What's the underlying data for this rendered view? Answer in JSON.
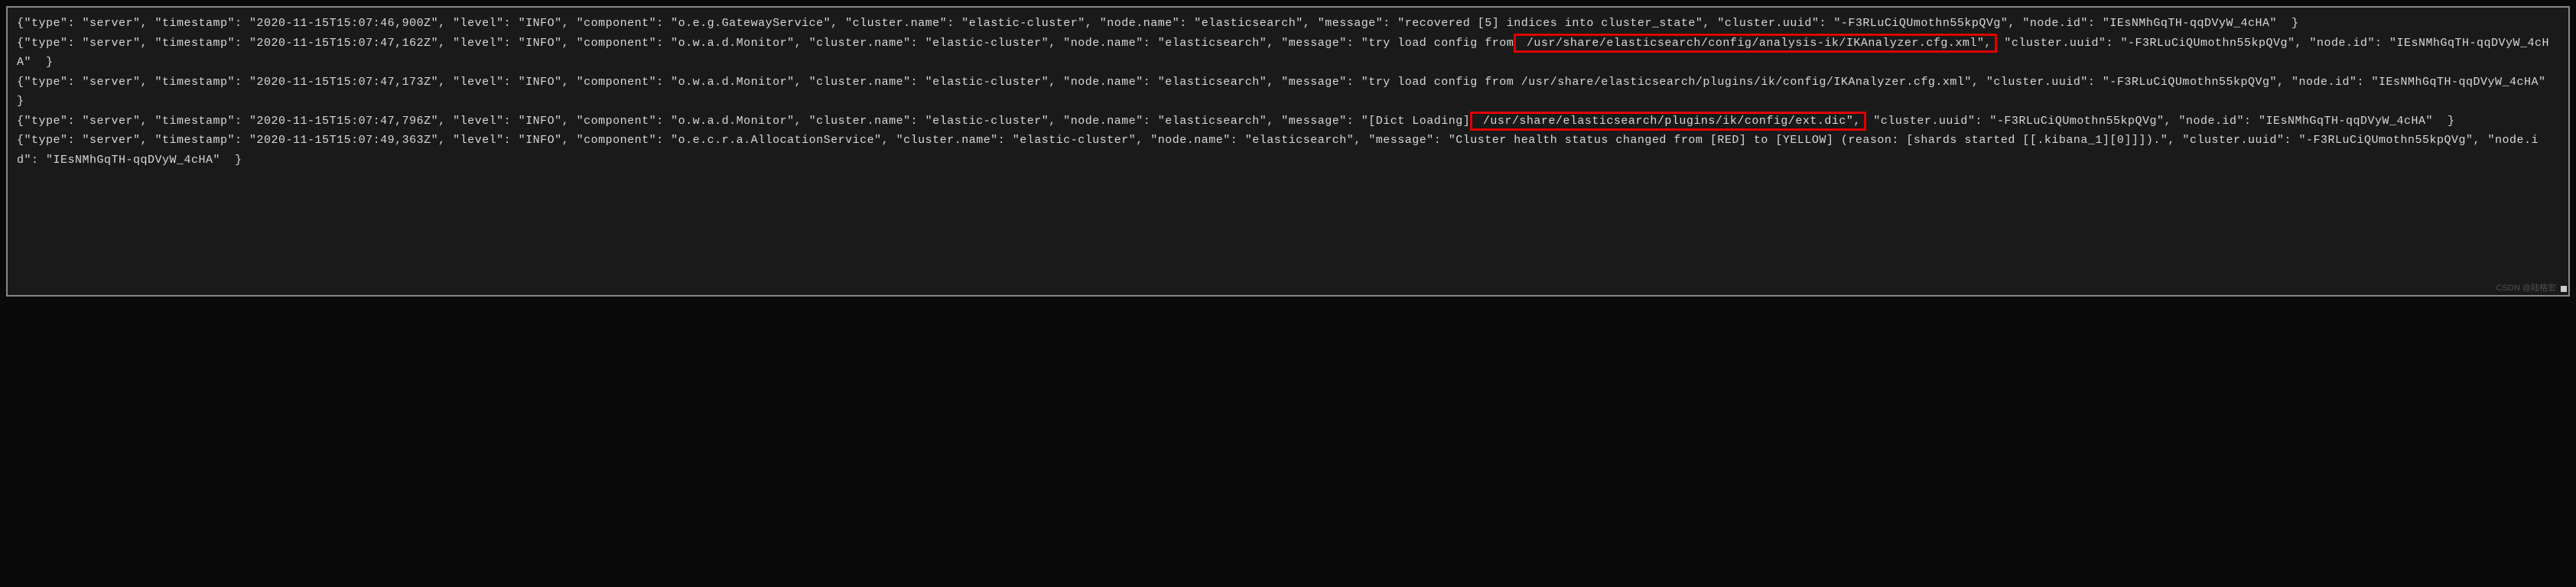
{
  "logs": [
    {
      "pre": "{\"type\": \"server\", \"timestamp\": \"2020-11-15T15:07:46,900Z\", \"level\": \"INFO\", \"component\": \"o.e.g.GatewayService\", \"cluster.name\": \"elastic-cluster\", \"node.name\": \"elasticsearch\", \"message\": \"recovered [5] indices into cluster_state\", \"cluster.uuid\": \"-F3RLuCiQUmothn55kpQVg\", \"node.id\": \"IEsNMhGqTH-qqDVyW_4cHA\"  }",
      "highlight": "",
      "post": ""
    },
    {
      "pre": "{\"type\": \"server\", \"timestamp\": \"2020-11-15T15:07:47,162Z\", \"level\": \"INFO\", \"component\": \"o.w.a.d.Monitor\", \"cluster.name\": \"elastic-cluster\", \"node.name\": \"elasticsearch\", \"message\": \"try load config from",
      "highlight": " /usr/share/elasticsearch/config/analysis-ik/IKAnalyzer.cfg.xml\",",
      "post": " \"cluster.uuid\": \"-F3RLuCiQUmothn55kpQVg\", \"node.id\": \"IEsNMhGqTH-qqDVyW_4cHA\"  }"
    },
    {
      "pre": "{\"type\": \"server\", \"timestamp\": \"2020-11-15T15:07:47,173Z\", \"level\": \"INFO\", \"component\": \"o.w.a.d.Monitor\", \"cluster.name\": \"elastic-cluster\", \"node.name\": \"elasticsearch\", \"message\": \"try load config from /usr/share/elasticsearch/plugins/ik/config/IKAnalyzer.cfg.xml\", \"cluster.uuid\": \"-F3RLuCiQUmothn55kpQVg\", \"node.id\": \"IEsNMhGqTH-qqDVyW_4cHA\"  }",
      "highlight": "",
      "post": ""
    },
    {
      "pre": "{\"type\": \"server\", \"timestamp\": \"2020-11-15T15:07:47,796Z\", \"level\": \"INFO\", \"component\": \"o.w.a.d.Monitor\", \"cluster.name\": \"elastic-cluster\", \"node.name\": \"elasticsearch\", \"message\": \"[Dict Loading]",
      "highlight": " /usr/share/elasticsearch/plugins/ik/config/ext.dic\",",
      "post": " \"cluster.uuid\": \"-F3RLuCiQUmothn55kpQVg\", \"node.id\": \"IEsNMhGqTH-qqDVyW_4cHA\"  }"
    },
    {
      "pre": "{\"type\": \"server\", \"timestamp\": \"2020-11-15T15:07:49,363Z\", \"level\": \"INFO\", \"component\": \"o.e.c.r.a.AllocationService\", \"cluster.name\": \"elastic-cluster\", \"node.name\": \"elasticsearch\", \"message\": \"Cluster health status changed from [RED] to [YELLOW] (reason: [shards started [[.kibana_1][0]]]).\", \"cluster.uuid\": \"-F3RLuCiQUmothn55kpQVg\", \"node.id\": \"IEsNMhGqTH-qqDVyW_4cHA\"  }",
      "highlight": "",
      "post": ""
    }
  ],
  "watermark": "CSDN @陆格宏"
}
